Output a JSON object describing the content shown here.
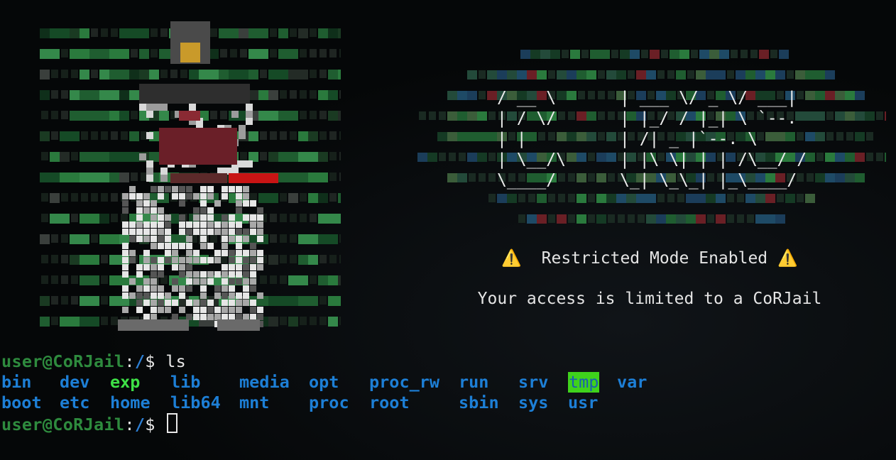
{
  "banner": {
    "warn_left": "⚠️",
    "title": "Restricted Mode Enabled",
    "warn_right": "⚠️",
    "subtitle": "Your access is limited to a CoRJail"
  },
  "logo": {
    "ascii_lines": [
      "/  __ \\",
      "| /  \\/",
      "| |    ",
      "| \\__/\\",
      " \\____/"
    ],
    "ascii_right": [
      "| ___ \\/ _ \\/  ___|",
      "| |_/ / |_| \\ `--. ",
      "|    /|  _  |`--. \\",
      "| |\\ \\| | | /\\__/ /",
      "\\_| \\_\\_| |_\\____/ "
    ]
  },
  "terminal": {
    "prompt_user": "user@CoRJail",
    "prompt_sep": ":",
    "prompt_path": "/",
    "prompt_end": "$ ",
    "command": "ls",
    "ls_row1": [
      "bin",
      "dev",
      "exp",
      "lib",
      "media",
      "opt",
      "proc_rw",
      "run",
      "srv",
      "tmp",
      "var"
    ],
    "ls_row2": [
      "boot",
      "etc",
      "home",
      "lib64",
      "mnt",
      "proc",
      "root",
      "sbin",
      "sys",
      "usr"
    ]
  },
  "colors": {
    "prompt_user": "#2e8b3e",
    "path": "#2d7fd4",
    "directory": "#1d7fd6",
    "executable": "#3ee046",
    "sticky_bg": "#3fd21c",
    "warning": "#f2b400"
  }
}
